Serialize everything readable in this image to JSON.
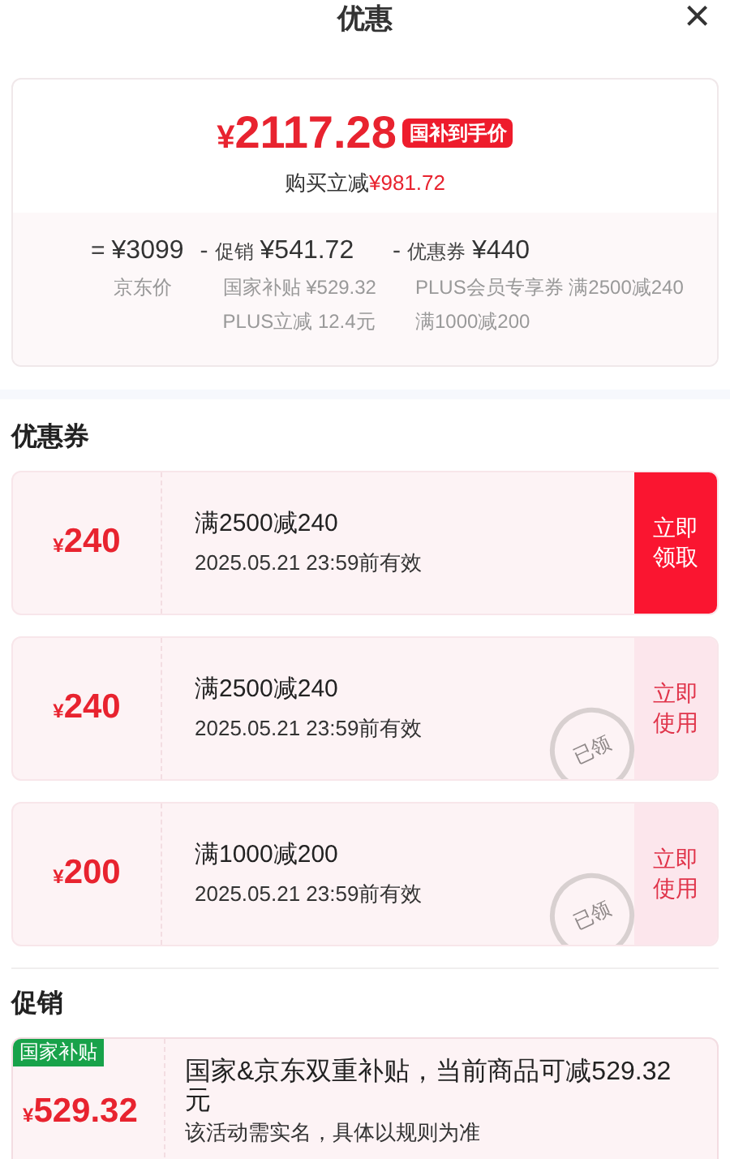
{
  "header": {
    "title": "优惠",
    "close": "×"
  },
  "price_card": {
    "price_symbol": "¥",
    "price": "2117.28",
    "price_tag": "国补到手价",
    "saving_label": "购买立减",
    "saving": "¥981.72",
    "breakdown": [
      {
        "sign": "=",
        "amount": "¥3099",
        "details": [
          "京东价"
        ]
      },
      {
        "sign": "-",
        "label": "促销",
        "amount": "¥541.72",
        "details": [
          "国家补贴 ¥529.32",
          "PLUS立减 12.4元"
        ]
      },
      {
        "sign": "-",
        "label": "优惠券",
        "amount": "¥440",
        "details": [
          "PLUS会员专享券 满2500减240",
          "满1000减200"
        ]
      }
    ]
  },
  "coupons_section": {
    "title": "优惠券",
    "coupons": [
      {
        "symbol": "¥",
        "amount": "240",
        "condition": "满2500减240",
        "validity": "2025.05.21 23:59前有效",
        "action": [
          "立即",
          "领取"
        ],
        "claimed": false
      },
      {
        "symbol": "¥",
        "amount": "240",
        "condition": "满2500减240",
        "validity": "2025.05.21 23:59前有效",
        "action": [
          "立即",
          "使用"
        ],
        "claimed": true,
        "stamp": "已领"
      },
      {
        "symbol": "¥",
        "amount": "200",
        "condition": "满1000减200",
        "validity": "2025.05.21 23:59前有效",
        "action": [
          "立即",
          "使用"
        ],
        "claimed": true,
        "stamp": "已领"
      }
    ]
  },
  "promotions_section": {
    "title": "促销",
    "promotions": [
      {
        "tag": "国家补贴",
        "symbol": "¥",
        "amount": "529.32",
        "description": "国家&京东双重补贴，当前商品可减529.32元",
        "note": "该活动需实名，具体以规则为准"
      }
    ]
  }
}
